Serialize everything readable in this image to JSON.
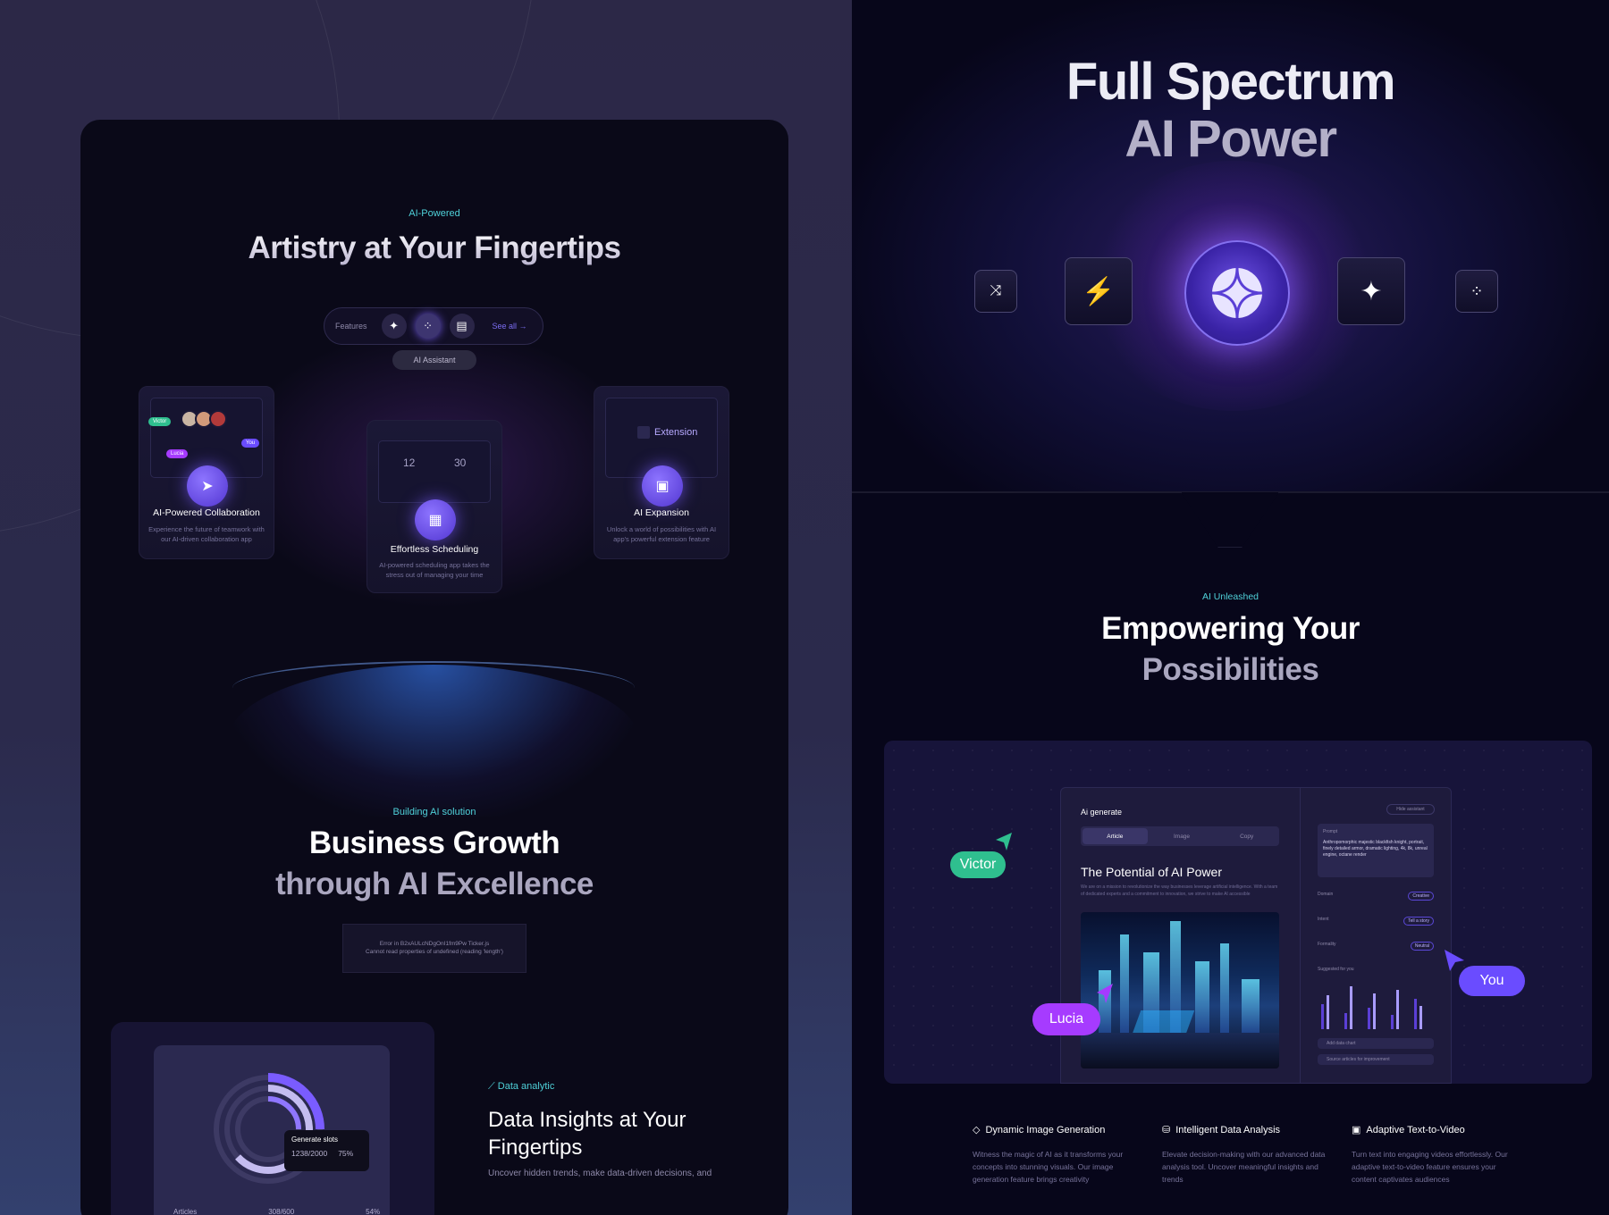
{
  "left": {
    "section1": {
      "eyebrow": "AI-Powered",
      "title": "Artistry at Your Fingertips",
      "features_label": "Features",
      "see_all": "See all →",
      "badge": "AI Assistant",
      "cards": [
        {
          "title": "AI-Powered Collaboration",
          "desc": "Experience the future of teamwork with our AI-driven collaboration app",
          "tags": [
            "Victor",
            "Lucia",
            "You"
          ]
        },
        {
          "title": "Effortless Scheduling",
          "desc": "AI-powered scheduling app takes the stress out of managing your time",
          "n1": "12",
          "n2": "30"
        },
        {
          "title": "AI Expansion",
          "desc": "Unlock a world of possibilities with AI app's powerful extension feature",
          "ext": "Extension"
        }
      ]
    },
    "section2": {
      "eyebrow": "Building AI solution",
      "title1": "Business Growth",
      "title2": "through AI Excellence",
      "error_line1": "Error in B2xAULcNDgOnI1fm9Pw Ticker.js",
      "error_line2": "Cannot read properties of undefined (reading 'length')"
    },
    "section3": {
      "eyebrow": "Data analytic",
      "title": "Data Insights at Your Fingertips",
      "sub": "Uncover hidden trends, make data-driven decisions, and",
      "tooltip_label": "Generate slots",
      "tooltip_value": "1238/2000",
      "tooltip_pct": "75%",
      "legend_label": "Articles",
      "legend_value": "308/600",
      "legend_pct": "54%"
    }
  },
  "right": {
    "hero": {
      "line1": "Full Spectrum",
      "line2": "AI Power"
    },
    "section": {
      "eyebrow": "AI Unleashed",
      "title1": "Empowering Your",
      "title2": "Possibilities"
    },
    "mock": {
      "app_title": "Ai generate",
      "tabs": [
        "Article",
        "Image",
        "Copy"
      ],
      "heading": "The Potential of AI Power",
      "desc": "We are on a mission to revolutionize the way businesses leverage artificial intelligence. With a team of dedicated experts and a commitment to innovation, we strive to make AI accessible",
      "hide_label": "Hide assistant",
      "prompt_label": "Prompt",
      "prompt_text": "Anthropomorphic majestic blackfish knight, portrait, finely detailed armor, dramatic lighting, 4k, 8k, unreal engine, octane render",
      "rows": [
        {
          "label": "Domain",
          "value": "Creative"
        },
        {
          "label": "Intent",
          "value": "Tell a story"
        },
        {
          "label": "Formality",
          "value": "Neutral"
        }
      ],
      "suggested": "Suggested for you",
      "opt1": "Add data chart",
      "opt2": "Source articles for improvement",
      "users": [
        "Victor",
        "Lucia",
        "You"
      ]
    },
    "features": [
      {
        "title": "Dynamic Image Generation",
        "desc": "Witness the magic of AI as it transforms your concepts into stunning visuals. Our image generation feature brings creativity"
      },
      {
        "title": "Intelligent Data Analysis",
        "desc": "Elevate decision-making with our advanced data analysis tool. Uncover meaningful insights and trends"
      },
      {
        "title": "Adaptive Text-to-Video",
        "desc": "Turn text into engaging videos effortlessly. Our adaptive text-to-video feature ensures your content captivates audiences"
      }
    ]
  },
  "colors": {
    "accent": "#7b5cff",
    "teal": "#4fd1d9",
    "victor": "#2fbf8f",
    "lucia": "#a63bff"
  }
}
